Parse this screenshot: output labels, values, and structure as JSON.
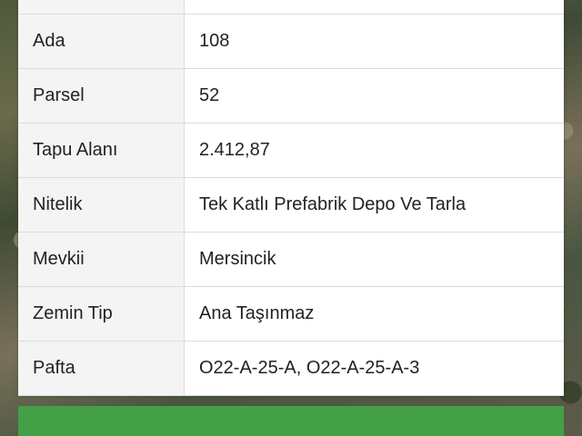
{
  "details": {
    "rows": [
      {
        "label": "",
        "value": ""
      },
      {
        "label": "Ada",
        "value": "108"
      },
      {
        "label": "Parsel",
        "value": "52"
      },
      {
        "label": "Tapu Alanı",
        "value": "2.412,87"
      },
      {
        "label": "Nitelik",
        "value": "Tek Katlı Prefabrik Depo Ve Tarla"
      },
      {
        "label": "Mevkii",
        "value": "Mersincik"
      },
      {
        "label": "Zemin Tip",
        "value": "Ana Taşınmaz"
      },
      {
        "label": "Pafta",
        "value": "O22-A-25-A, O22-A-25-A-3"
      }
    ]
  },
  "action": {
    "label": ""
  },
  "colors": {
    "action_green": "#43a047",
    "label_bg": "#f4f4f4",
    "border": "#dcdcdc"
  }
}
